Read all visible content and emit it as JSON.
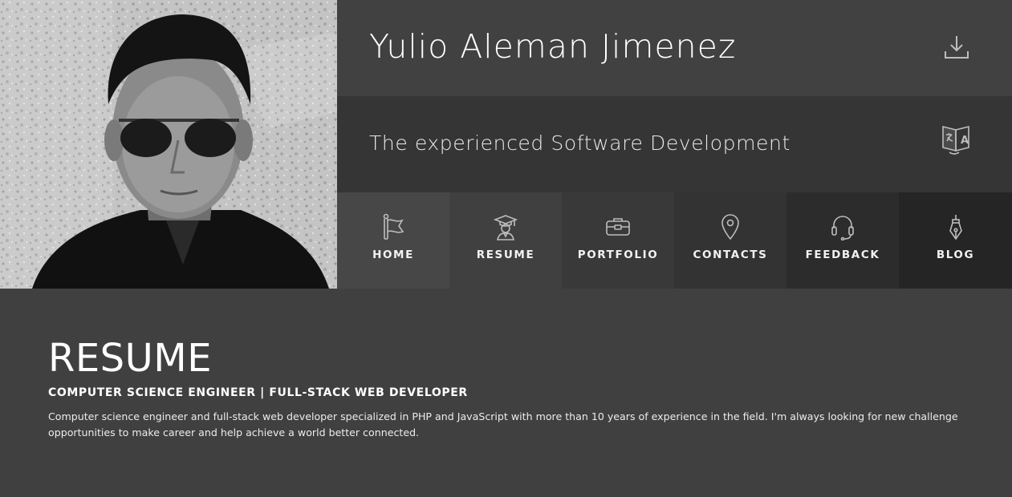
{
  "header": {
    "name": "Yulio Aleman Jimenez",
    "tagline": "The experienced Software Development",
    "download_icon": "download-icon",
    "translate_icon": "translate-icon"
  },
  "photo": {
    "alt": "profile-photo"
  },
  "nav": {
    "items": [
      {
        "label": "HOME",
        "icon": "flag-icon",
        "bg": "#474747",
        "active": true
      },
      {
        "label": "RESUME",
        "icon": "graduate-icon",
        "bg": "#404040",
        "active": false
      },
      {
        "label": "PORTFOLIO",
        "icon": "briefcase-icon",
        "bg": "#393939",
        "active": false
      },
      {
        "label": "CONTACTS",
        "icon": "location-pin-icon",
        "bg": "#333333",
        "active": false
      },
      {
        "label": "FEEDBACK",
        "icon": "headset-icon",
        "bg": "#2c2c2c",
        "active": false
      },
      {
        "label": "BLOG",
        "icon": "pen-nib-icon",
        "bg": "#252525",
        "active": false
      }
    ]
  },
  "main": {
    "title": "RESUME",
    "subtitle": "COMPUTER SCIENCE ENGINEER | FULL-STACK WEB DEVELOPER",
    "description": "Computer science engineer and full-stack web developer specialized in PHP and JavaScript with more than 10 years of experience in the field. I'm always looking for new challenge opportunities to make career and help achieve a world better connected."
  },
  "colors": {
    "name_row_bg": "#414141",
    "tag_row_bg": "#353535",
    "content_bg": "#404040",
    "icon_stroke": "#bdbdbd"
  }
}
